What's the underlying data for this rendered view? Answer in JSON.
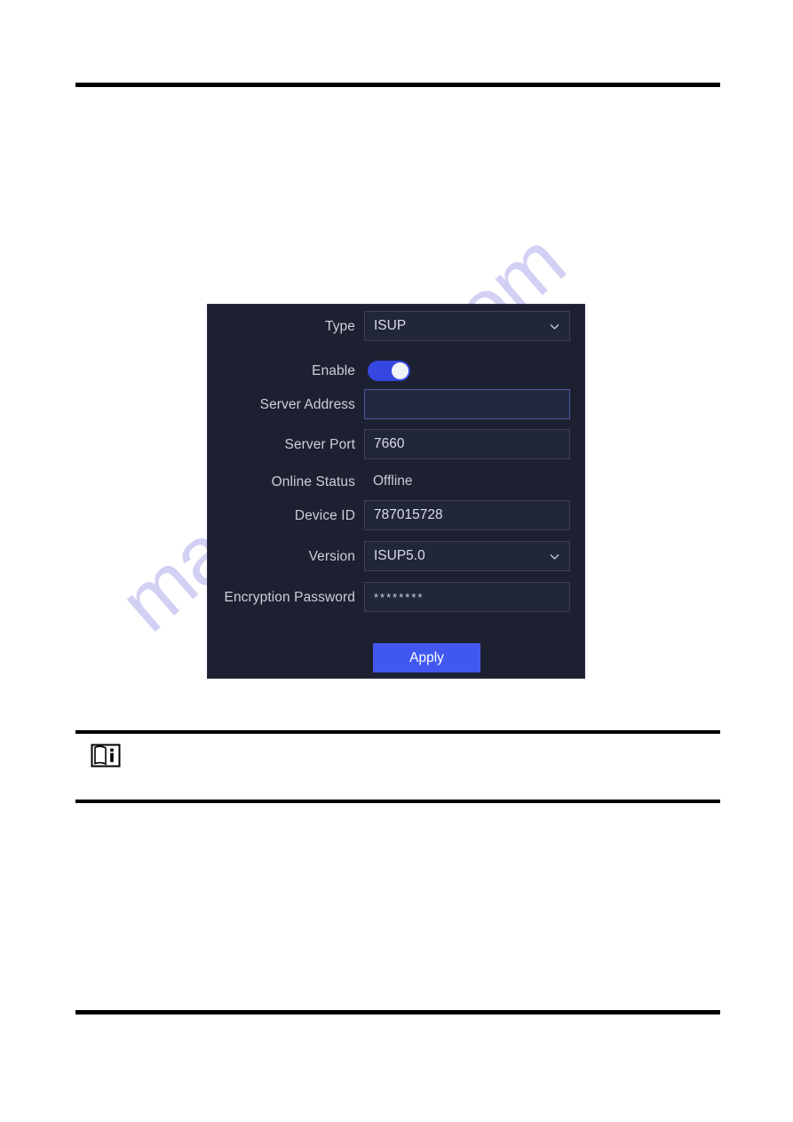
{
  "page": {
    "watermark": "manualslib.com",
    "watermark_color": "#b7b4ec"
  },
  "note": {
    "icon": "note-book-info-icon",
    "text": ""
  },
  "dialog": {
    "name": "isup-platform-access-settings",
    "background_color": "#1d2030",
    "accent_color": "#4158f0",
    "rows": [
      {
        "label": "Type",
        "control": "select",
        "value": "ISUP",
        "options": [
          "ISUP"
        ]
      },
      {
        "label": "Enable",
        "control": "toggle",
        "value": "on"
      },
      {
        "label": "Server Address",
        "control": "text",
        "value": "",
        "placeholder": ""
      },
      {
        "label": "Server Port",
        "control": "text",
        "value": "7660",
        "placeholder": ""
      },
      {
        "label": "Online Status",
        "control": "static",
        "value": "Offline"
      },
      {
        "label": "Device ID",
        "control": "text",
        "value": "787015728",
        "placeholder": ""
      },
      {
        "label": "Version",
        "control": "select",
        "value": "ISUP5.0",
        "options": [
          "ISUP5.0"
        ]
      },
      {
        "label": "Encryption Password",
        "control": "password",
        "value": "********",
        "placeholder": ""
      }
    ],
    "apply_label": "Apply"
  }
}
